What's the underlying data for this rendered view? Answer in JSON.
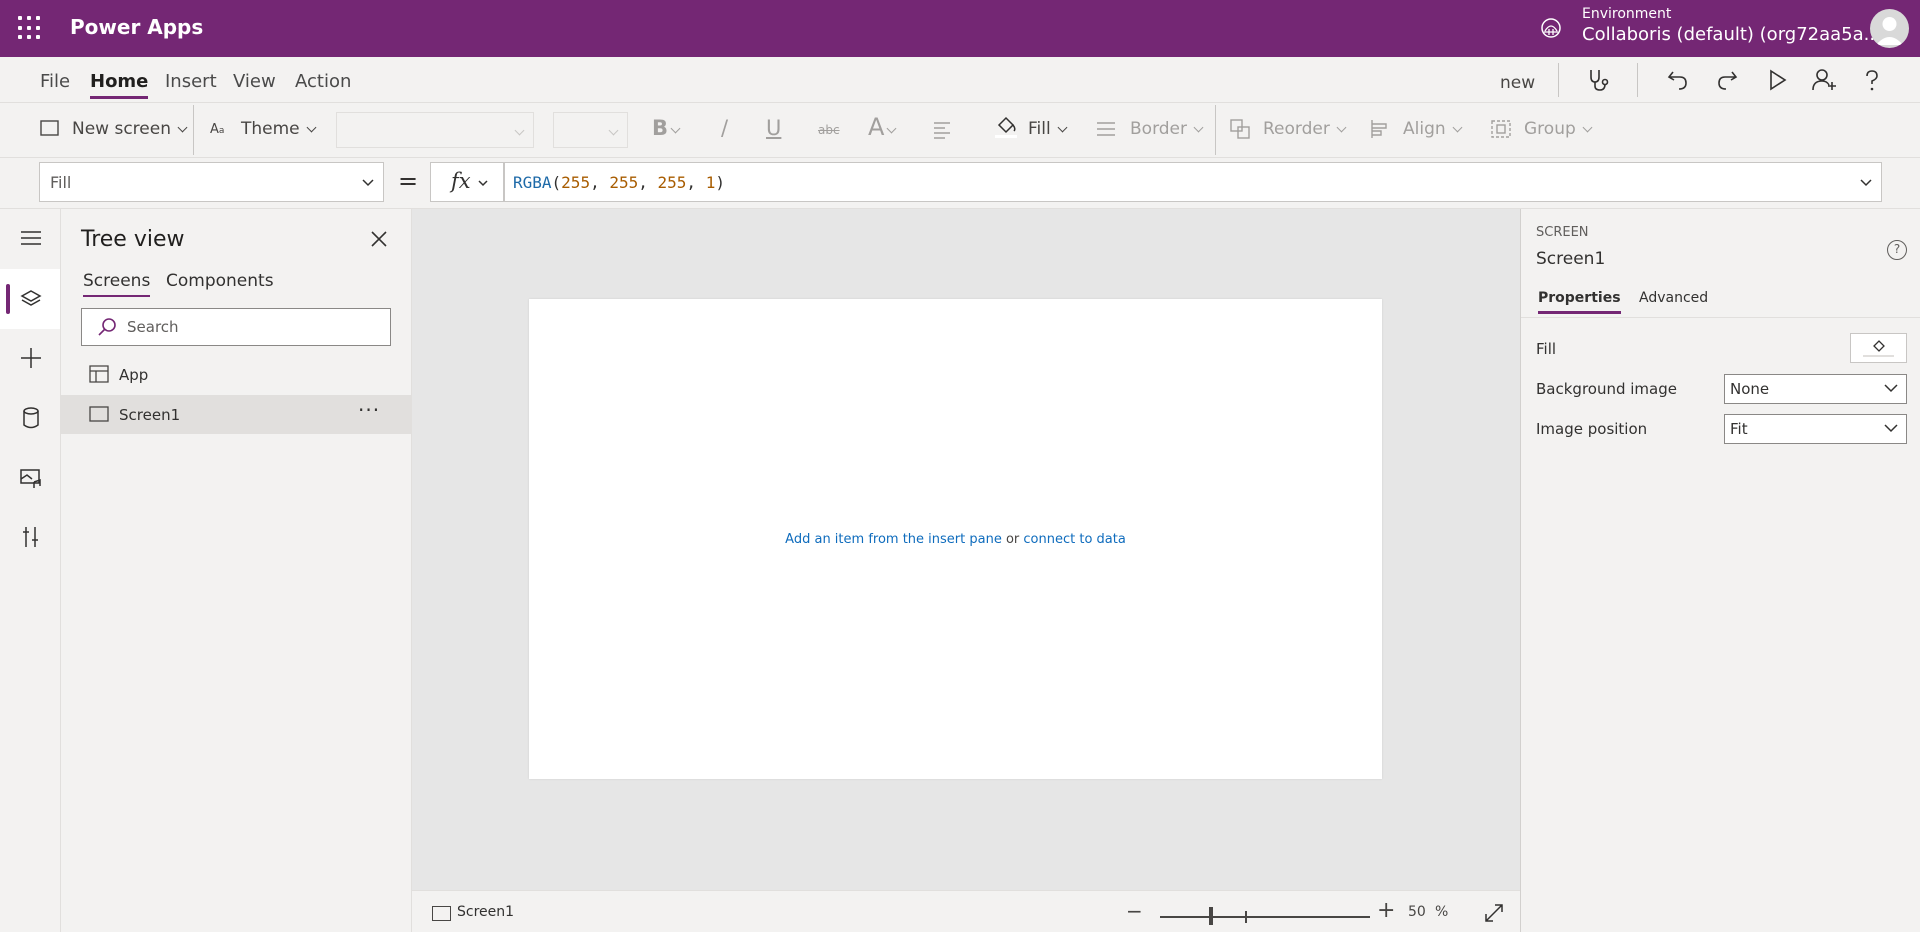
{
  "app": {
    "title": "Power Apps",
    "environment_label": "Environment",
    "environment_value": "Collaboris (default) (org72aa5a...",
    "brand_color": "#742774"
  },
  "menu": {
    "tabs": [
      "File",
      "Home",
      "Insert",
      "View",
      "Action"
    ],
    "active_tab": "Home",
    "new_label": "new",
    "icons": [
      "stethoscope-icon",
      "undo-icon",
      "redo-icon",
      "play-icon",
      "share-icon",
      "help-icon"
    ]
  },
  "ribbon": {
    "new_screen": "New screen",
    "theme": "Theme",
    "bold": "B",
    "italic": "/",
    "underline": "U",
    "strike": "abc",
    "font_color": "A",
    "fill": "Fill",
    "border": "Border",
    "reorder": "Reorder",
    "align": "Align",
    "group": "Group"
  },
  "formula": {
    "property": "Fill",
    "equals": "=",
    "fx": "fx",
    "fn": "RGBA",
    "args": [
      "255",
      "255",
      "255",
      "1"
    ]
  },
  "rail": {
    "items": [
      "hamburger-icon",
      "tree-view-icon",
      "insert-icon",
      "data-icon",
      "media-icon",
      "tools-icon"
    ],
    "active": "tree-view-icon"
  },
  "tree": {
    "title": "Tree view",
    "tabs": [
      "Screens",
      "Components"
    ],
    "active_tab": "Screens",
    "search_placeholder": "Search",
    "items": [
      {
        "label": "App",
        "icon": "app-icon",
        "selected": false
      },
      {
        "label": "Screen1",
        "icon": "screen-icon",
        "selected": true,
        "more": "···"
      }
    ]
  },
  "canvas": {
    "hint_link1": "Add an item from the insert pane",
    "hint_or": " or ",
    "hint_link2": "connect to data"
  },
  "status": {
    "screen": "Screen1",
    "zoom_minus": "−",
    "zoom_plus": "+",
    "zoom": "50",
    "zoom_unit": "%"
  },
  "properties": {
    "kind": "SCREEN",
    "name": "Screen1",
    "help": "?",
    "tabs": [
      "Properties",
      "Advanced"
    ],
    "active_tab": "Properties",
    "fill_label": "Fill",
    "background_image_label": "Background image",
    "background_image_value": "None",
    "image_position_label": "Image position",
    "image_position_value": "Fit"
  }
}
